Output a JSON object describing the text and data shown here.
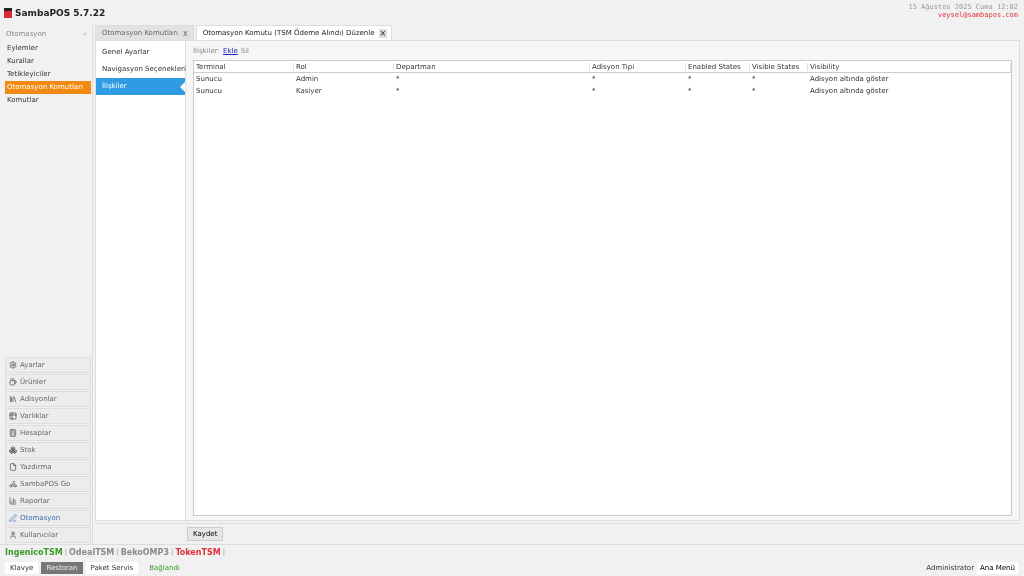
{
  "app": {
    "title": "SambaPOS 5.7.22",
    "datetime": "15 Ağustos 2025 Cuma 12:02",
    "user_email": "veysel@sambapos.com"
  },
  "sidebar": {
    "header": "Otomasyon",
    "collapse": "‹",
    "items": [
      {
        "label": "Eylemler",
        "selected": false
      },
      {
        "label": "Kurallar",
        "selected": false
      },
      {
        "label": "Tetikleyiciler",
        "selected": false
      },
      {
        "label": "Otomasyon Komutları",
        "selected": true
      },
      {
        "label": "Komutlar",
        "selected": false
      }
    ],
    "modules": [
      {
        "label": "Ayarlar",
        "selected": false
      },
      {
        "label": "Ürünler",
        "selected": false
      },
      {
        "label": "Adisyonlar",
        "selected": false
      },
      {
        "label": "Varlıklar",
        "selected": false
      },
      {
        "label": "Hesaplar",
        "selected": false
      },
      {
        "label": "Stok",
        "selected": false
      },
      {
        "label": "Yazdırma",
        "selected": false
      },
      {
        "label": "SambaPOS Go",
        "selected": false
      },
      {
        "label": "Raporlar",
        "selected": false
      },
      {
        "label": "Otomasyon",
        "selected": true
      },
      {
        "label": "Kullanıcılar",
        "selected": false
      }
    ]
  },
  "tabs": [
    {
      "label": "Otomasyon Komutları",
      "close": "x",
      "selected": false
    },
    {
      "label": "Otomasyon Komutu (TSM Ödeme Alındı) Düzenle",
      "close": "×",
      "selected": true
    }
  ],
  "sections": [
    {
      "label": "Genel Ayarlar",
      "selected": false
    },
    {
      "label": "Navigasyon Seçenekleri",
      "selected": false
    },
    {
      "label": "İlişkiler",
      "selected": true
    }
  ],
  "relations": {
    "label": "İlişkiler:",
    "add": "Ekle",
    "delete": "Sil",
    "columns": [
      "Terminal",
      "Rol",
      "Departman",
      "Adisyon Tipi",
      "Enabled States",
      "Visible States",
      "Visibility"
    ],
    "rows": [
      [
        "Sunucu",
        "Admin",
        "*",
        "*",
        "*",
        "*",
        "Adisyon altında göster"
      ],
      [
        "Sunucu",
        "Kasiyer",
        "*",
        "*",
        "*",
        "*",
        "Adisyon altında göster"
      ]
    ]
  },
  "save_button": "Kaydet",
  "devices": [
    {
      "label": "IngenicoTSM",
      "separator": "|",
      "color": "#3a9a2a"
    },
    {
      "label": "OdealTSM",
      "separator": "|",
      "color": "#8a8a8a"
    },
    {
      "label": "BekoOMP3",
      "separator": "|",
      "color": "#8a8a8a"
    },
    {
      "label": "TokenTSM",
      "separator": "|",
      "color": "#e0303a"
    }
  ],
  "bottom_bar": {
    "buttons": [
      {
        "label": "Klavye",
        "selected": false
      },
      {
        "label": "Restoran",
        "selected": true
      },
      {
        "label": "Paket Servis",
        "selected": false
      }
    ],
    "status": "Bağlandı",
    "user": "Administrator",
    "menu": "Ana Menü"
  }
}
